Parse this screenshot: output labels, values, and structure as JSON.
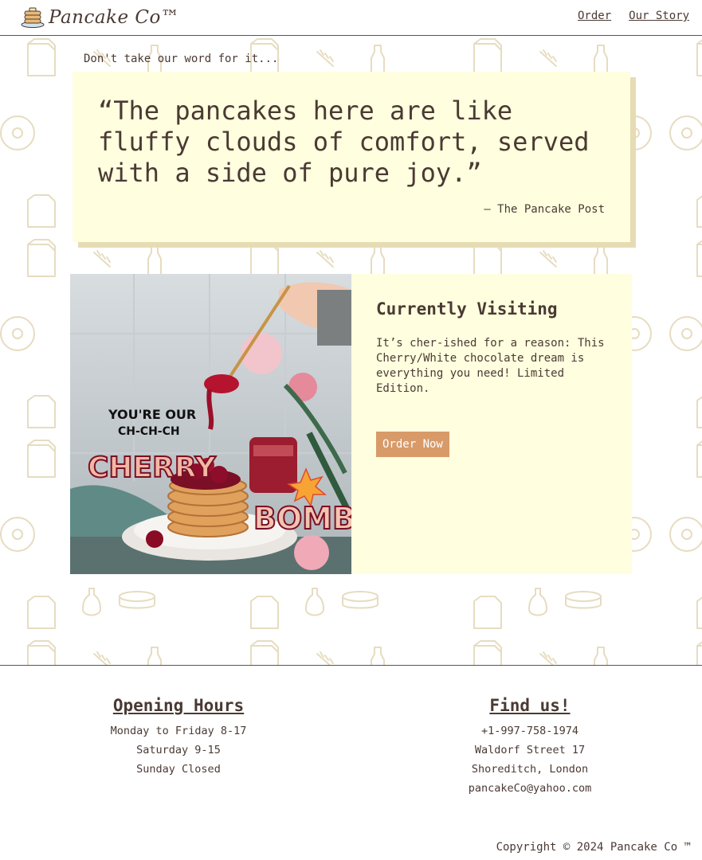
{
  "brand": {
    "name": "Pancake Co™",
    "logo_icon": "pancake-stack-icon"
  },
  "nav": {
    "items": [
      {
        "label": "Order"
      },
      {
        "label": "Our Story"
      }
    ]
  },
  "testimonial": {
    "intro": "Don't take our word for it...",
    "quote": "“The pancakes here are like fluffy clouds of comfort, served with a side of pure joy.”",
    "author": "– The Pancake Post"
  },
  "feature": {
    "image_texts": {
      "line1": "YOU'RE OUR",
      "line2": "CH-CH-CH",
      "cherry": "CHERRY",
      "bomb": "BOMB!"
    },
    "title": "Currently Visiting",
    "description": "It’s cher-ished for a reason: This Cherry/White chocolate dream is everything you need! Limited Edition.",
    "button": "Order Now"
  },
  "footer": {
    "hours": {
      "heading": "Opening Hours",
      "lines": [
        "Monday to Friday 8-17",
        "Saturday 9-15",
        "Sunday Closed"
      ]
    },
    "find": {
      "heading": "Find us!",
      "lines": [
        "+1-997-758-1974",
        "Waldorf Street 17",
        "Shoreditch, London",
        "pancakeCo@yahoo.com"
      ]
    },
    "copyright": "Copyright © 2024 Pancake Co ™"
  },
  "colors": {
    "accent": "#d89a68",
    "cream": "#fffedf",
    "text": "#4a3a33",
    "pattern": "#e6dcc0"
  }
}
